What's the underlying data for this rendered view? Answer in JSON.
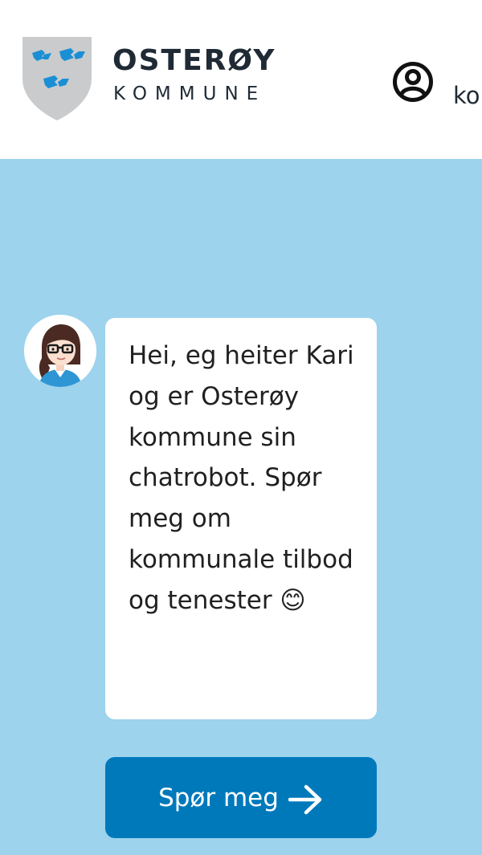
{
  "header": {
    "brand": "OSTERØY",
    "brand_sub": "KOMMUNE",
    "account_label": "ko"
  },
  "chat": {
    "message": "Hei, eg heiter Kari og er Osterøy kommune sin chatrobot. Spør meg om kommunale tilbod og tenester 😊",
    "button_label": "Spør meg"
  },
  "colors": {
    "hero_background": "#9dd3ed",
    "button_background": "#0079bb",
    "logo_blue": "#1a8fd6",
    "shield_grey": "#c9cbcc",
    "text_dark": "#1f2a35"
  },
  "icons": {
    "logo": "coat-of-arms-icon",
    "account": "user-circle-icon",
    "avatar": "chatbot-avatar",
    "arrow": "arrow-right-icon"
  }
}
